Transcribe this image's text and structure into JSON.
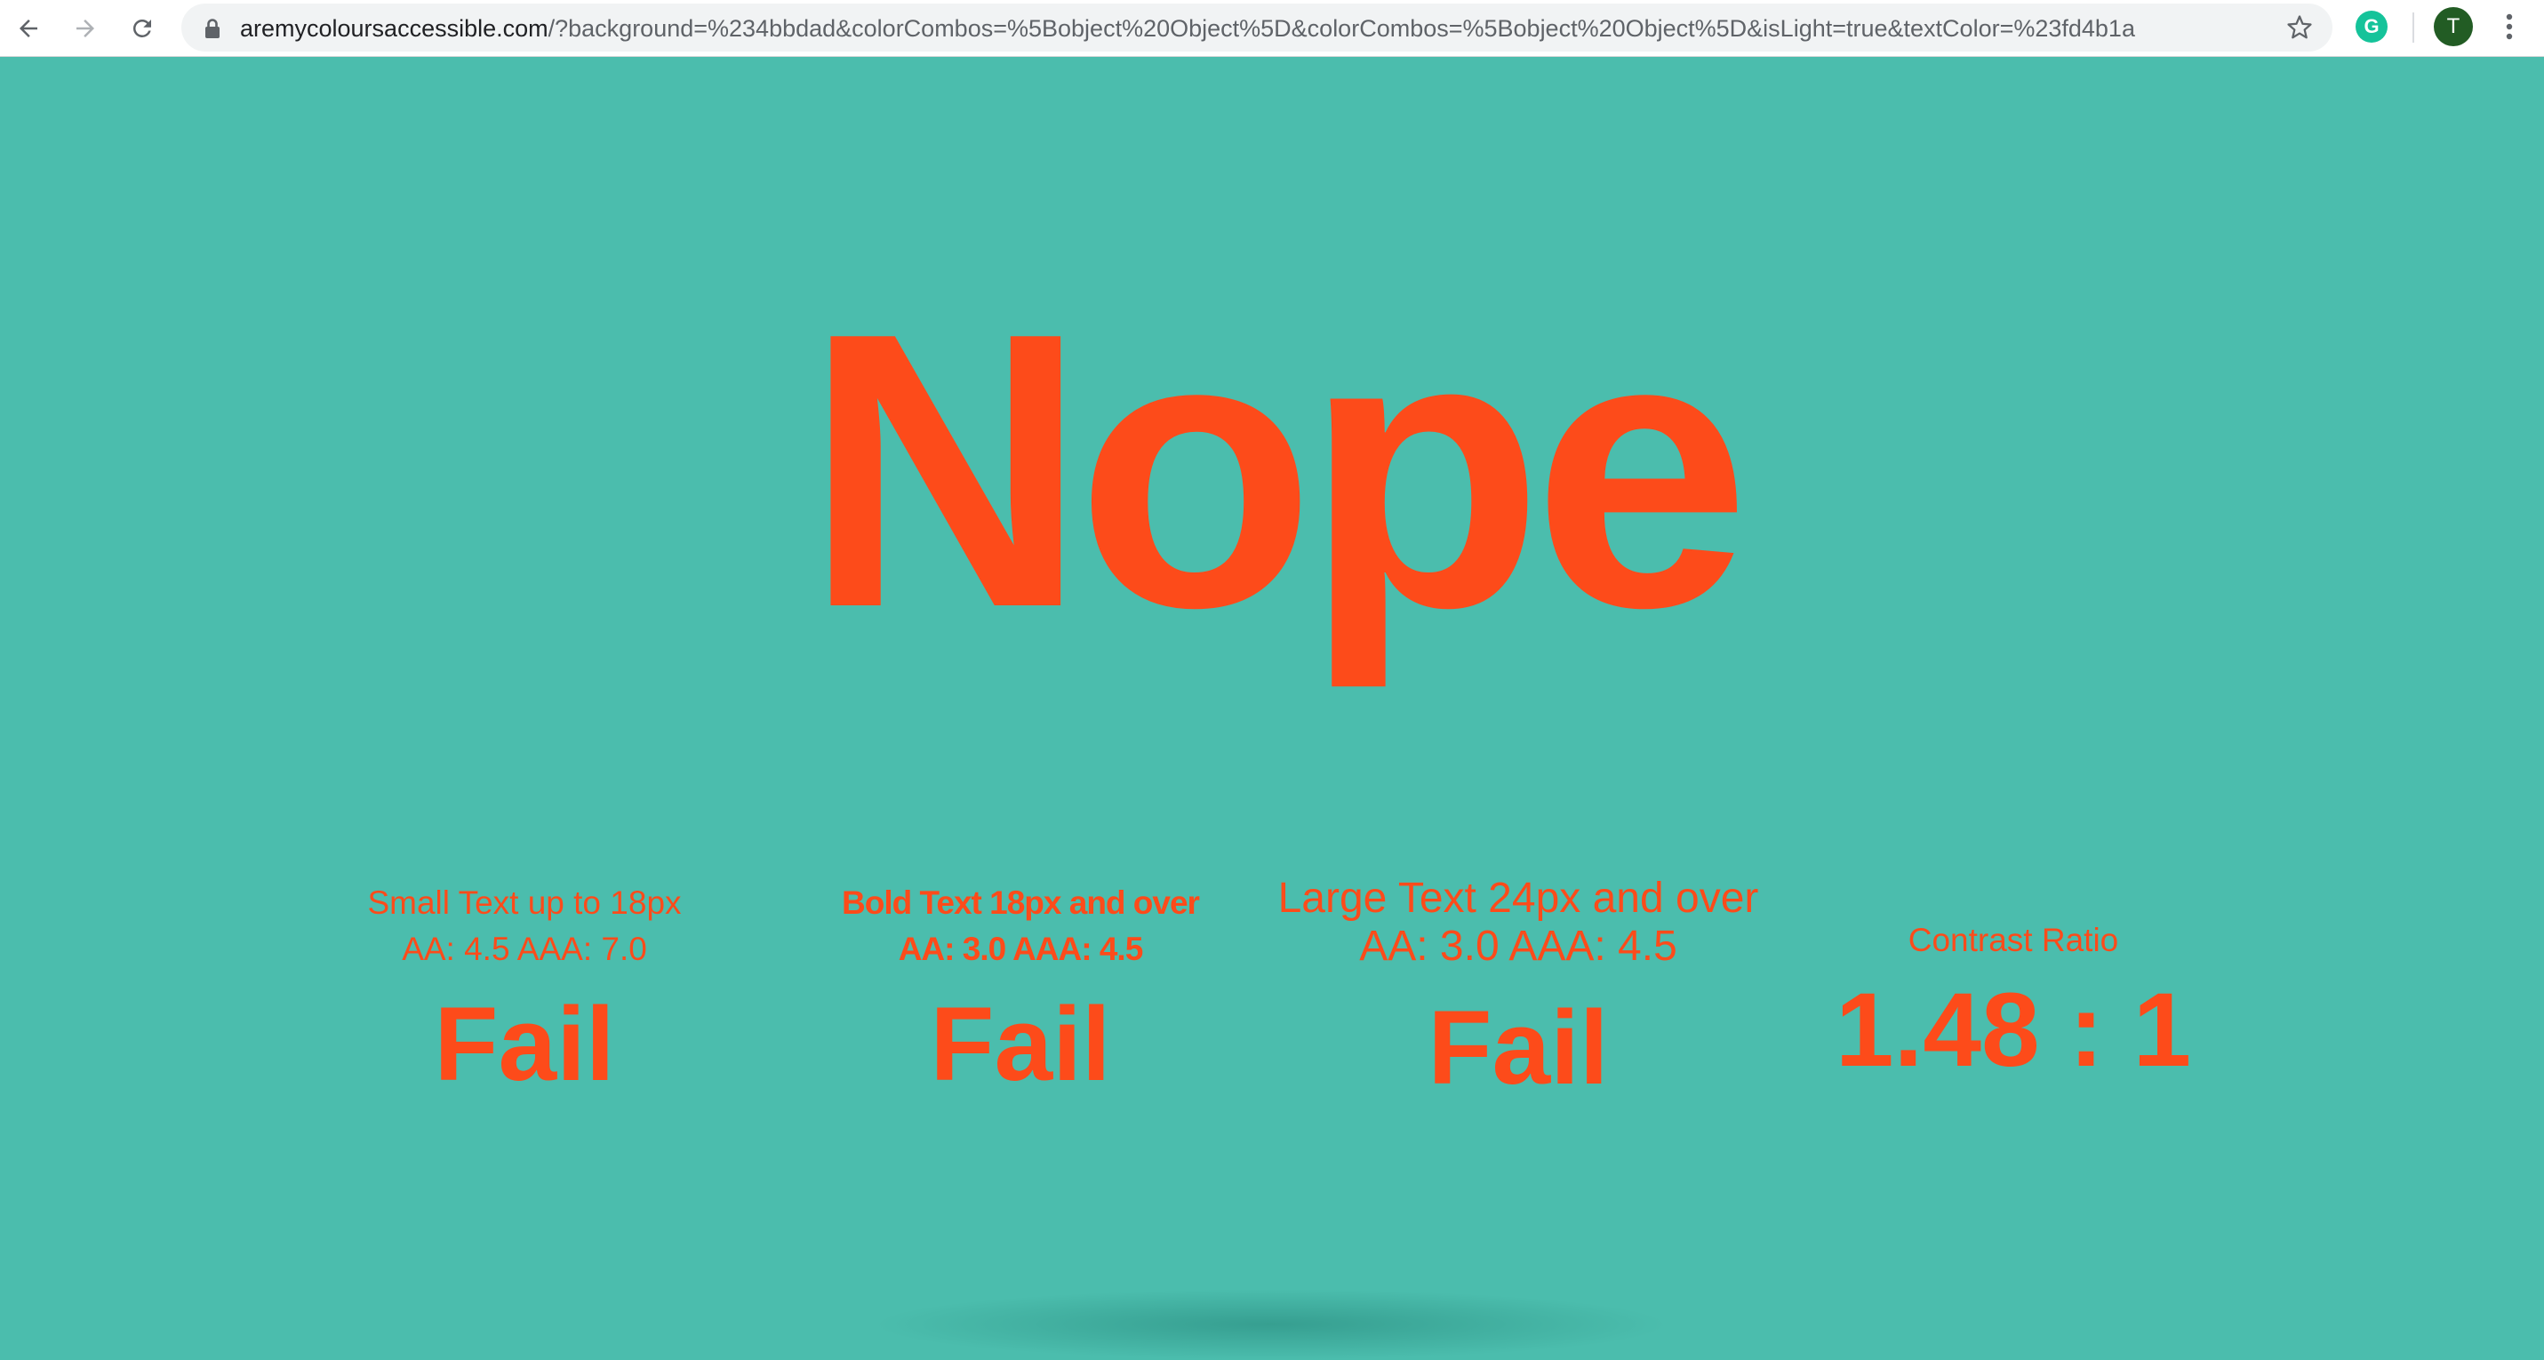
{
  "browser": {
    "url_host": "aremycoloursaccessible.com",
    "url_path": "/?background=%234bbdad&colorCombos=%5Bobject%20Object%5D&colorCombos=%5Bobject%20Object%5D&isLight=true&textColor=%23fd4b1a",
    "avatar_letter": "T",
    "extension_letter": "G",
    "icons": {
      "back": "back-arrow-icon",
      "forward": "forward-arrow-icon",
      "reload": "reload-icon",
      "lock": "lock-icon",
      "bookmark": "star-icon",
      "extension": "grammarly-icon",
      "menu": "kebab-menu-icon"
    }
  },
  "colors": {
    "background": "#4bbdad",
    "text": "#fd4b1a"
  },
  "verdict": "Nope",
  "results": [
    {
      "title": "Small Text up to 18px",
      "thresholds": "AA: 4.5 AAA: 7.0",
      "result": "Fail"
    },
    {
      "title": "Bold Text 18px and over",
      "thresholds": "AA: 3.0 AAA: 4.5",
      "result": "Fail"
    },
    {
      "title": "Large Text 24px and over",
      "thresholds": "AA: 3.0 AAA: 4.5",
      "result": "Fail"
    }
  ],
  "contrast": {
    "label": "Contrast Ratio",
    "value": "1.48 : 1"
  }
}
